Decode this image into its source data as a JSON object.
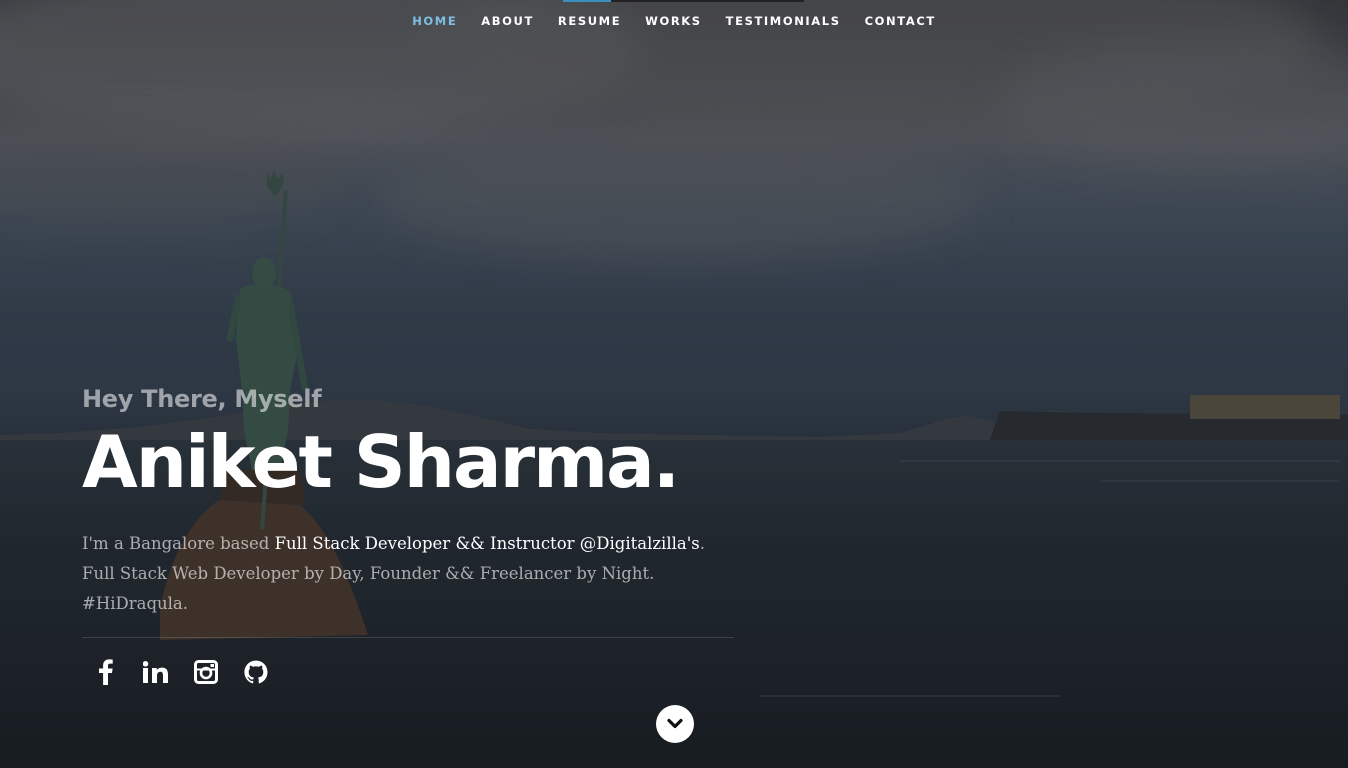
{
  "nav": {
    "items": [
      {
        "label": "HOME",
        "active": true
      },
      {
        "label": "ABOUT"
      },
      {
        "label": "RESUME"
      },
      {
        "label": "WORKS"
      },
      {
        "label": "TESTIMONIALS"
      },
      {
        "label": "CONTACT"
      }
    ],
    "accent_color": "#7fbfe3"
  },
  "banner": {
    "greeting": "Hey There, Myself",
    "name": "Aniket Sharma.",
    "intro_prefix": "I'm a Bangalore based ",
    "intro_strong": "Full Stack Developer && Instructor @Digitalzilla's",
    "intro_suffix": ". Full Stack Web Developer by Day, Founder && Freelancer by Night. #HiDraqula."
  },
  "social": [
    {
      "icon": "facebook-icon"
    },
    {
      "icon": "linkedin-icon"
    },
    {
      "icon": "instagram-icon"
    },
    {
      "icon": "github-icon"
    }
  ],
  "scroll": {
    "icon": "chevron-down-icon"
  }
}
